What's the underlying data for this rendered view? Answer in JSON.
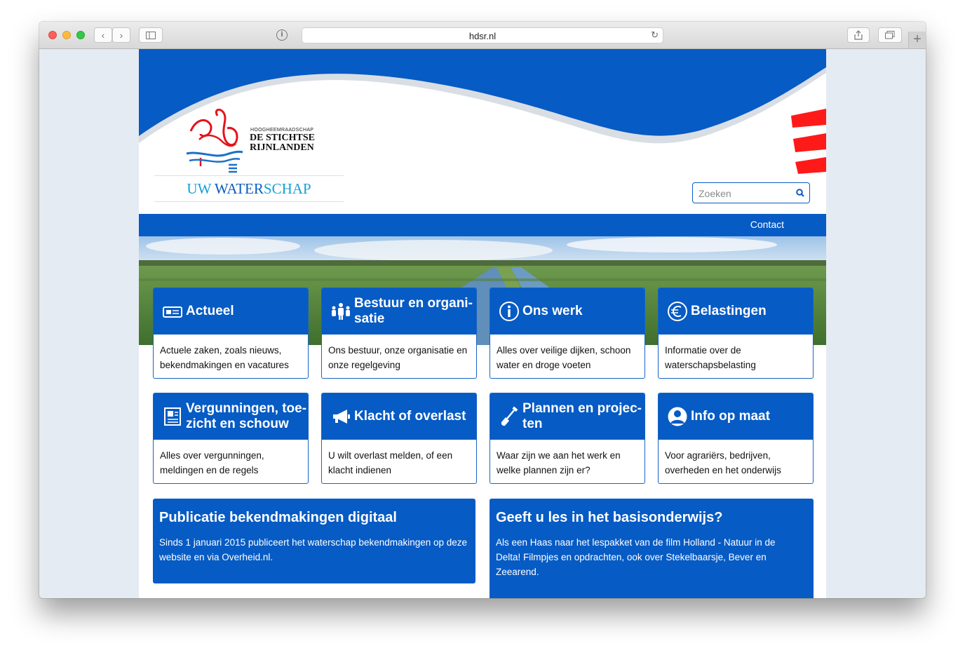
{
  "browser": {
    "url": "hdsr.nl"
  },
  "header": {
    "org_small": "HOOGHEEMRAADSCHAP",
    "org_line1": "DE STICHTSE",
    "org_line2": "RIJNLANDEN",
    "tagline_part1": "UW ",
    "tagline_part2": "WATER",
    "tagline_part3": "SCHAP"
  },
  "search": {
    "placeholder": "Zoeken"
  },
  "nav": {
    "contact": "Contact"
  },
  "tiles": [
    {
      "icon": "newspaper-icon",
      "title_line1": "Actueel",
      "title_line2": "",
      "desc": "Actuele zaken, zoals nieuws, bekendmakingen en vacatures"
    },
    {
      "icon": "people-icon",
      "title_line1": "Bestuur en organi-",
      "title_line2": "satie",
      "desc": "Ons bestuur, onze organisatie en onze regelgeving"
    },
    {
      "icon": "info-icon",
      "title_line1": "Ons werk",
      "title_line2": "",
      "desc": "Alles over veilige dijken, schoon water en droge voeten"
    },
    {
      "icon": "euro-icon",
      "title_line1": "Belastingen",
      "title_line2": "",
      "desc": "Informatie over de waterschapsbelasting"
    },
    {
      "icon": "permit-document-icon",
      "title_line1": "Vergunningen, toe-",
      "title_line2": "zicht en schouw",
      "desc": "Alles over vergunningen, meldingen en de regels"
    },
    {
      "icon": "megaphone-icon",
      "title_line1": "Klacht of overlast",
      "title_line2": "",
      "desc": "U wilt overlast melden, of een klacht indienen"
    },
    {
      "icon": "shovel-icon",
      "title_line1": "Plannen en projec-",
      "title_line2": "ten",
      "desc": "Waar zijn we aan het werk en welke plannen zijn er?"
    },
    {
      "icon": "user-icon",
      "title_line1": "Info op maat",
      "title_line2": "",
      "desc": "Voor agrariërs, bedrijven, overheden en het onderwijs"
    }
  ],
  "banners": [
    {
      "title": "Publicatie bekendmakingen digitaal",
      "text": "Sinds 1 januari 2015 publiceert het waterschap bekendmakingen op deze website en via Overheid.nl."
    },
    {
      "title": "Geeft u les in het basisonderwijs?",
      "text": "Als een Haas naar het lespakket van de film Holland - Natuur in de Delta! Filmpjes en opdrachten, ook over Stekelbaarsje, Bever en Zeearend."
    }
  ],
  "colors": {
    "brand_blue": "#065bc4",
    "accent_red": "#ff1a1a",
    "tagline_light": "#18a0d6",
    "tagline_dark": "#0a5cc1"
  }
}
